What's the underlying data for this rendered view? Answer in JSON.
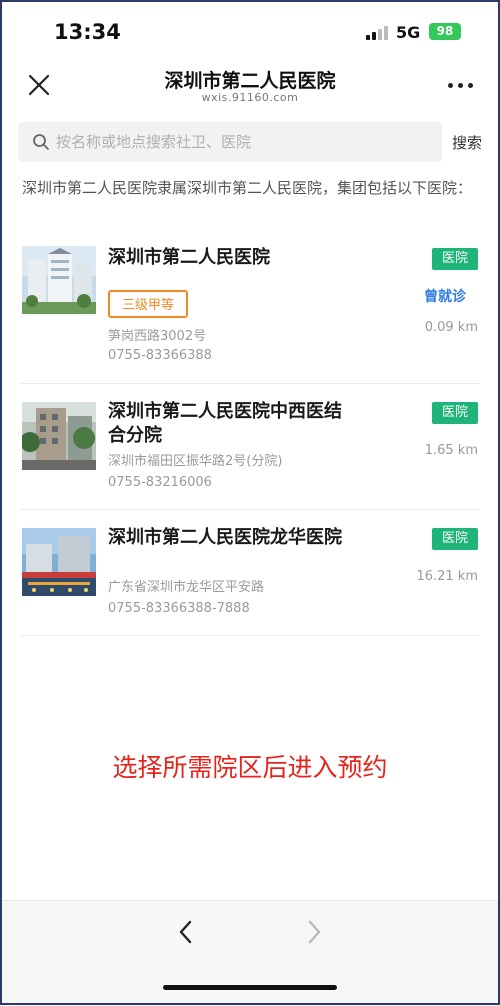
{
  "status_bar": {
    "time": "13:34",
    "network": "5G",
    "battery": "98"
  },
  "header": {
    "title": "深圳市第二人民医院",
    "subtitle": "wxis.91160.com"
  },
  "search": {
    "placeholder": "按名称或地点搜索社卫、医院",
    "button_label": "搜索"
  },
  "intro": "深圳市第二人民医院隶属深圳市第二人民医院，集团包括以下医院：",
  "hospitals": [
    {
      "name": "深圳市第二人民医院",
      "tag": "医院",
      "level": "三级甲等",
      "visited": "曾就诊",
      "address": "笋岗西路3002号",
      "phone": "0755-83366388",
      "distance": "0.09 km"
    },
    {
      "name": "深圳市第二人民医院中西医结合分院",
      "tag": "医院",
      "address": "深圳市福田区振华路2号(分院)",
      "phone": "0755-83216006",
      "distance": "1.65 km"
    },
    {
      "name": "深圳市第二人民医院龙华医院",
      "tag": "医院",
      "address": "广东省深圳市龙华区平安路",
      "phone": "0755-83366388-7888",
      "distance": "16.21 km"
    }
  ],
  "note": "选择所需院区后进入预约",
  "colors": {
    "accent_green": "#1fb47a",
    "level_orange": "#f08a24",
    "link_blue": "#2d7be5",
    "note_red": "#e6241c"
  }
}
